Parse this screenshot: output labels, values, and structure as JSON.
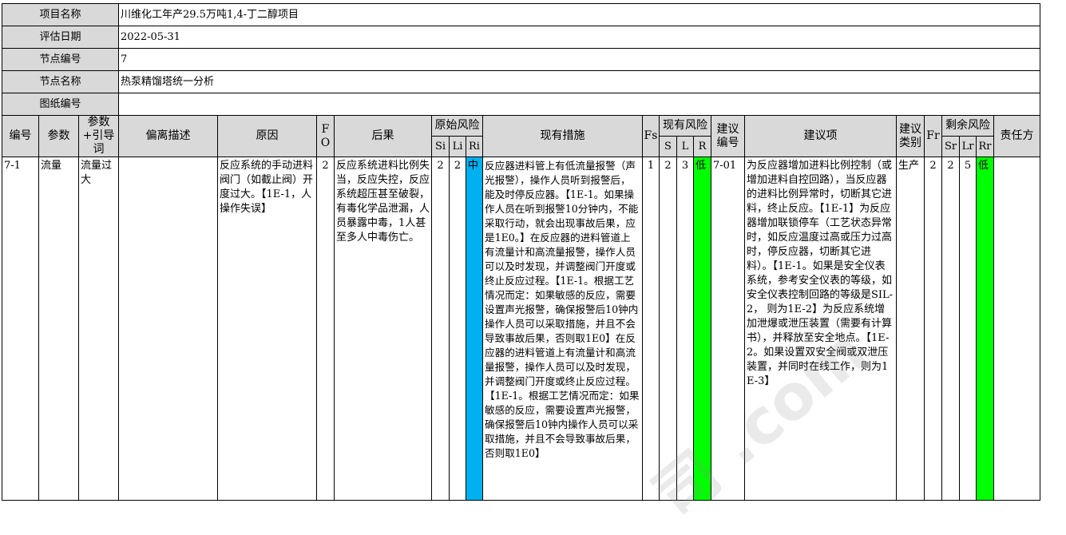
{
  "info": [
    {
      "label": "项目名称",
      "value": "川维化工年产29.5万吨1,4-丁二醇项目"
    },
    {
      "label": "评估日期",
      "value": "2022-05-31"
    },
    {
      "label": "节点编号",
      "value": "7"
    },
    {
      "label": "节点名称",
      "value": "热泵精馏塔统一分析"
    },
    {
      "label": "图纸编号",
      "value": ""
    }
  ],
  "headers": {
    "no": "编号",
    "param": "参数",
    "guide": "参数+引导词",
    "deviation": "偏离描述",
    "cause": "原因",
    "fo": "FO",
    "consequence": "后果",
    "orig_risk": "原始风险",
    "si": "Si",
    "li": "Li",
    "ri": "Ri",
    "measures": "现有措施",
    "fs": "Fs",
    "cur_risk": "现有风险",
    "s": "S",
    "l": "L",
    "r": "R",
    "rec_no": "建议编号",
    "rec": "建议项",
    "rec_type": "建议类别",
    "fr": "Fr",
    "res_risk": "剩余风险",
    "sr": "Sr",
    "lr": "Lr",
    "rr": "Rr",
    "owner": "责任方"
  },
  "row": {
    "no": "7-1",
    "param": "流量",
    "guide": "流量过大",
    "deviation": "",
    "cause": "反应系统的手动进料阀门（如截止阀）开度过大。【1E-1，人操作失误】",
    "fo": "2",
    "consequence": "反应系统进料比例失当，反应失控，反应系统超压甚至破裂，有毒化学品泄漏，人员暴露中毒，1人甚至多人中毒伤亡。",
    "si": "2",
    "li": "2",
    "ri": "中",
    "measures": "反应器进料管上有低流量报警（声光报警），操作人员听到报警后，能及时停反应器。【1E-1。如果操作人员在听到报警10分钟内，不能采取行动，就会出现事故后果，应是1E0。】在反应器的进料管道上有流量计和高流量报警，操作人员可以及时发现，并调整阀门开度或终止反应过程。【1E-1。根据工艺情况而定：如果敏感的反应，需要设置声光报警，确保报警后10钟内操作人员可以采取措施，并且不会导致事故后果，否则取1E0】在反应器的进料管道上有流量计和高流量报警，操作人员可以及时发现，并调整阀门开度或终止反应过程。【1E-1。根据工艺情况而定：如果敏感的反应，需要设置声光报警，确保报警后10钟内操作人员可以采取措施，并且不会导致事故后果，否则取1E0】",
    "fs": "1",
    "s": "2",
    "l": "3",
    "r": "低",
    "rec_no": "7-01",
    "rec": "为反应器增加进料比例控制（或增加进料自控回路），当反应器的进料比例异常时，切断其它进料，终止反应。【1E-1】为反应器增加联锁停车（工艺状态异常时，如反应温度过高或压力过高时，停反应器，切断其它进料）。【1E-1。如果是安全仪表系统，参考安全仪表的等级，如安全仪表控制回路的等级是SIL-2， 则为1E-2】为反应系统增加泄爆或泄压装置（需要有计算书），并释放至安全地点。【1E-2。如果设置双安全阀或双泄压装置，并同时在线工作，则为1E-3】",
    "rec_type": "生产",
    "fr": "2",
    "sr": "2",
    "lr": "5",
    "rr": "低",
    "owner": ""
  },
  "colors": {
    "medium": "#00b0f0",
    "low": "#00ff00",
    "header_bg": "#d9d9d9"
  }
}
